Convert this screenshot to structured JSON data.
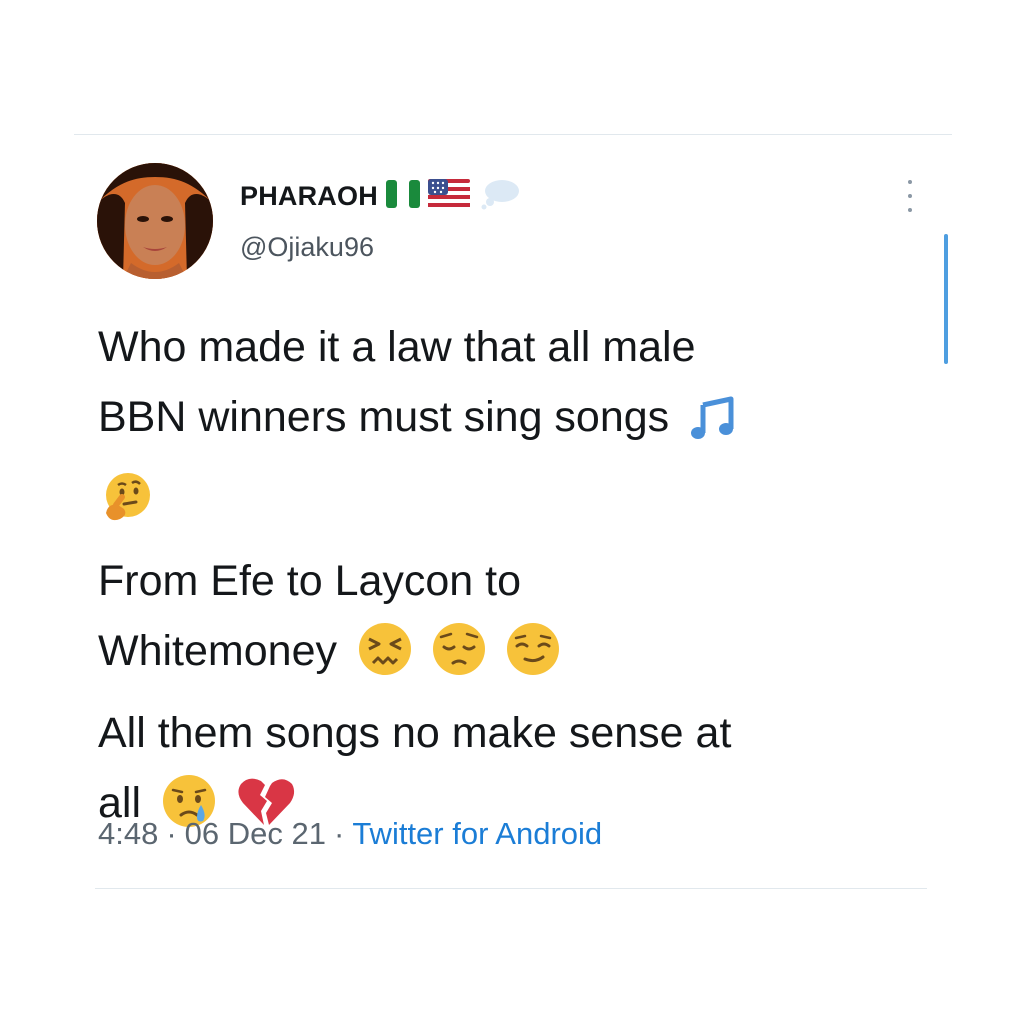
{
  "user": {
    "display_name": "PHARAOH",
    "handle": "@Ojiaku96",
    "badges": [
      "nigeria-flag-icon",
      "usa-flag-icon",
      "thought-balloon-icon"
    ]
  },
  "tweet": {
    "lines": [
      "Who made it a law that all male",
      "BBN winners must sing songs",
      "",
      "From Efe to Laycon to",
      "Whitemoney",
      "All them songs no make sense at",
      "all"
    ],
    "emojis": {
      "line2": [
        "musical-notes-icon"
      ],
      "line3": [
        "thinking-face-icon"
      ],
      "line5": [
        "confounded-face-icon",
        "pensive-face-icon",
        "relieved-face-icon"
      ],
      "line7": [
        "crying-face-icon",
        "broken-heart-icon"
      ]
    }
  },
  "meta": {
    "time": "4:48",
    "date": "06 Dec 21",
    "separator": "·",
    "source": "Twitter for Android"
  },
  "colors": {
    "text": "#14171a",
    "muted": "#5b6670",
    "link": "#1b7dd6",
    "scrollbar": "#4e9ee0",
    "divider": "#e1e8ed"
  }
}
